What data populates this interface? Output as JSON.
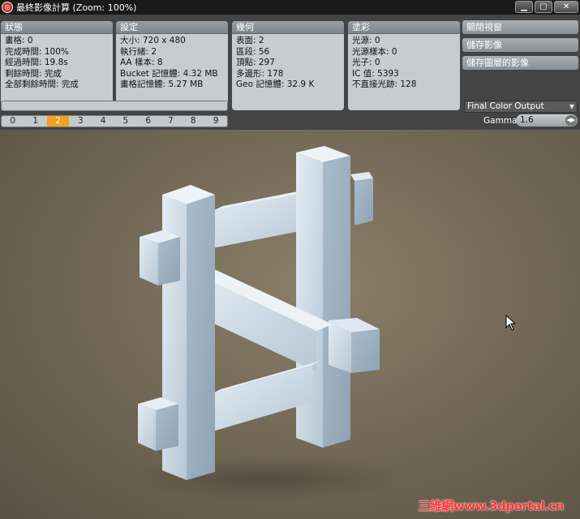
{
  "window": {
    "title": "最終影像計算 (Zoom: 100%)",
    "controls": [
      "minimize-icon",
      "maximize-icon",
      "close-icon"
    ]
  },
  "status": {
    "header": "狀態",
    "lines": [
      "畫格: 0",
      "完成時間: 100%",
      "經過時間: 19.8s",
      "剩餘時間: 完成",
      "全部剩餘時間: 完成"
    ]
  },
  "settings": {
    "header": "設定",
    "lines": [
      "大小: 720 x 480",
      "執行緒: 2",
      "AA 樣本: 8",
      "Bucket 記憶體: 4.32 MB",
      "畫格記憶體: 5.27 MB"
    ]
  },
  "geometry": {
    "header": "幾何",
    "lines": [
      "表面: 2",
      "區段: 56",
      "頂點: 297",
      "多邊形: 178",
      "Geo 記憶體: 32.9 K"
    ]
  },
  "shading": {
    "header": "塗彩",
    "lines": [
      "光源: 0",
      "光源樣本: 0",
      "光子: 0",
      "IC 值: 5393",
      "不直接光跡: 128"
    ]
  },
  "actions": {
    "close_viewer": "關閉視窗",
    "save_image": "儲存影像",
    "save_layered": "儲存圖層的影像"
  },
  "progress": 1.0,
  "buffers": {
    "items": [
      "0",
      "1",
      "2",
      "3",
      "4",
      "5",
      "6",
      "7",
      "8",
      "9"
    ],
    "active_index": 2
  },
  "output": {
    "selected": "Final Color Output"
  },
  "gamma": {
    "label": "Gamma",
    "value": "1.6"
  },
  "watermark": "三維網www.3dportal.cn",
  "colors": {
    "accent": "#f0a020",
    "panel_bg": "#444444",
    "group_bg": "#c9ccce",
    "header_bg": "#8a9094",
    "beam": "#d6e2ee",
    "background": "#6f6553"
  }
}
